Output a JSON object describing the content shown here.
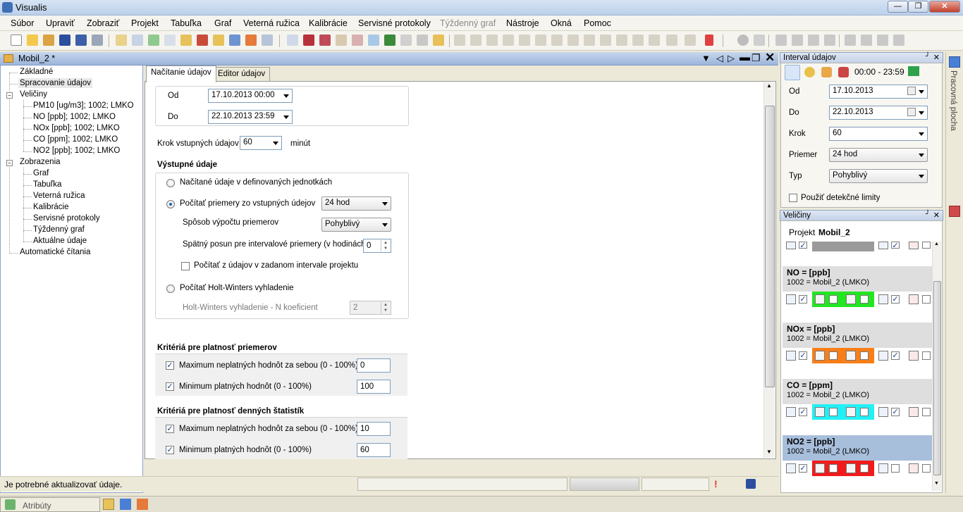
{
  "window": {
    "title": "Visualis"
  },
  "menu": [
    "Súbor",
    "Upraviť",
    "Zobraziť",
    "Projekt",
    "Tabuľka",
    "Graf",
    "Veterná ružica",
    "Kalibrácie",
    "Servisné protokoly",
    "Týždenný graf",
    "Nástroje",
    "Okná",
    "Pomoc"
  ],
  "document": {
    "title": "Mobil_2 *"
  },
  "tree": {
    "zakladne": "Základné",
    "spracovanie": "Spracovanie údajov",
    "veliciny": "Veličiny",
    "veliciny_items": [
      "PM10 [ug/m3]; 1002; LMKO",
      "NO [ppb]; 1002; LMKO",
      "NOx [ppb]; 1002; LMKO",
      "CO [ppm]; 1002; LMKO",
      "NO2 [ppb]; 1002; LMKO"
    ],
    "zobrazenia": "Zobrazenia",
    "zobrazenia_items": [
      "Graf",
      "Tabuľka",
      "Veterná ružica",
      "Kalibrácie",
      "Servisné protokoly",
      "Týždenný graf",
      "Aktuálne údaje"
    ],
    "automaticke": "Automatické čítania"
  },
  "tabs": {
    "nacitanie": "Načítanie údajov",
    "editor": "Editor údajov"
  },
  "form": {
    "od_label": "Od",
    "od_value": "17.10.2013 00:00",
    "do_label": "Do",
    "do_value": "22.10.2013 23:59",
    "krok_label": "Krok vstupných údajov",
    "krok_value": "60",
    "krok_unit": "minút",
    "vystupne": "Výstupné údaje",
    "radio1": "Načítané údaje v definovaných jednotkách",
    "radio2": "Počítať priemery zo vstupných údejov",
    "radio2_value": "24 hod",
    "sposob_label": "Spôsob výpočtu priemerov",
    "sposob_value": "Pohyblivý",
    "spatny_label": "Spätný posun pre intervalové priemery (v hodinách)",
    "spatny_value": "0",
    "pocitat_label": "Počítať z údajov v zadanom intervale projektu",
    "radio3": "Počítať Holt-Winters vyhladenie",
    "holt_label": "Holt-Winters vyhladenie - N koeficient",
    "holt_value": "2",
    "krit_priem_title": "Kritériá pre platnosť priemerov",
    "krit1_label": "Maximum neplatných hodnôt za sebou (0 - 100%)",
    "krit1_value": "0",
    "krit2_label": "Minimum platných hodnôt (0 - 100%)",
    "krit2_value": "100",
    "krit_den_title": "Kritériá pre platnosť denných štatistík",
    "krit3_label": "Maximum neplatných hodnôt za sebou (0 - 100%)",
    "krit3_value": "10",
    "krit4_label": "Minimum platných hodnôt (0 - 100%)",
    "krit4_value": "60"
  },
  "status": {
    "message": "Je potrebné aktualizovať údaje."
  },
  "bottom": {
    "atributy": "Atribúty"
  },
  "interval": {
    "title": "Interval údajov",
    "time_range": "00:00 - 23:59",
    "od_label": "Od",
    "od_value": "17.10.2013",
    "do_label": "Do",
    "do_value": "22.10.2013",
    "krok_label": "Krok",
    "krok_value": "60",
    "priemer_label": "Priemer",
    "priemer_value": "24 hod",
    "typ_label": "Typ",
    "typ_value": "Pohyblivý",
    "detekcne_label": "Použiť detekčné limity"
  },
  "veliciny_panel": {
    "title": "Veličiny",
    "projekt_label": "Projekt",
    "projekt_value": "Mobil_2",
    "items": [
      {
        "name": "NO =  [ppb]",
        "sub": "1002 = Mobil_2 (LMKO)",
        "color": "#22e622"
      },
      {
        "name": "NOx =  [ppb]",
        "sub": "1002 = Mobil_2 (LMKO)",
        "color": "#f97e18"
      },
      {
        "name": "CO =  [ppm]",
        "sub": "1002 = Mobil_2 (LMKO)",
        "color": "#22f0f5"
      },
      {
        "name": "NO2 =  [ppb]",
        "sub": "1002 = Mobil_2 (LMKO)",
        "color": "#f21a1a"
      }
    ],
    "top_color": "#9a9a9a"
  },
  "rightstrip": {
    "label": "Pracovná plocha"
  }
}
